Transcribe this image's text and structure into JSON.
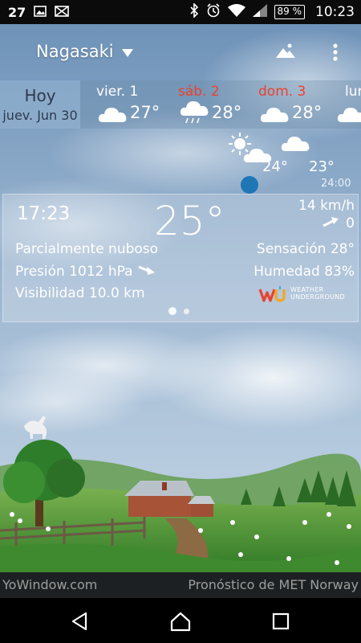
{
  "status_bar": {
    "temperature": "27",
    "battery": "89 %",
    "time": "10:23",
    "icons": [
      "image-icon",
      "crossed-flag-icon",
      "bluetooth-icon",
      "alarm-icon",
      "wifi-icon",
      "signal-icon",
      "battery-icon"
    ]
  },
  "header": {
    "city": "Nagasaki",
    "actions": [
      "landscape-icon",
      "more-vert-icon"
    ]
  },
  "forecast": {
    "today": {
      "line1": "Hoy",
      "line2": "juev. Jun 30"
    },
    "days": [
      {
        "name": "vier. 1",
        "temp": "27°",
        "icon": "cloud-icon",
        "weekend": false
      },
      {
        "name": "sáb. 2",
        "temp": "28°",
        "icon": "rain-cloud-icon",
        "weekend": true
      },
      {
        "name": "dom. 3",
        "temp": "28°",
        "icon": "cloud-icon",
        "weekend": true
      },
      {
        "name": "lur",
        "temp": "",
        "icon": "cloud-icon",
        "weekend": false
      }
    ]
  },
  "hourly": {
    "temp_now": "24°",
    "temp_next": "23°",
    "time_label": "24:00"
  },
  "current": {
    "clock": "17:23",
    "temperature": "25°",
    "wind_speed": "14 km/h",
    "wind_gust": "0",
    "condition": "Parcialmente nuboso",
    "pressure": "Presión 1012 hPa",
    "visibility": "Visibilidad 10.0 km",
    "feels_like": "Sensación 28°",
    "humidity": "Humedad 83%",
    "provider_line1": "WEATHER",
    "provider_line2": "UNDERGROUND",
    "page_count": 2,
    "page_active": 1
  },
  "footer": {
    "left": "YoWindow.com",
    "right": "Pronóstico de MET Norway"
  },
  "colors": {
    "accent_red": "#e9432f",
    "dot_blue": "#1f76b5",
    "sky_top": "#6a8fb6",
    "grass": "#3f8a2e"
  }
}
